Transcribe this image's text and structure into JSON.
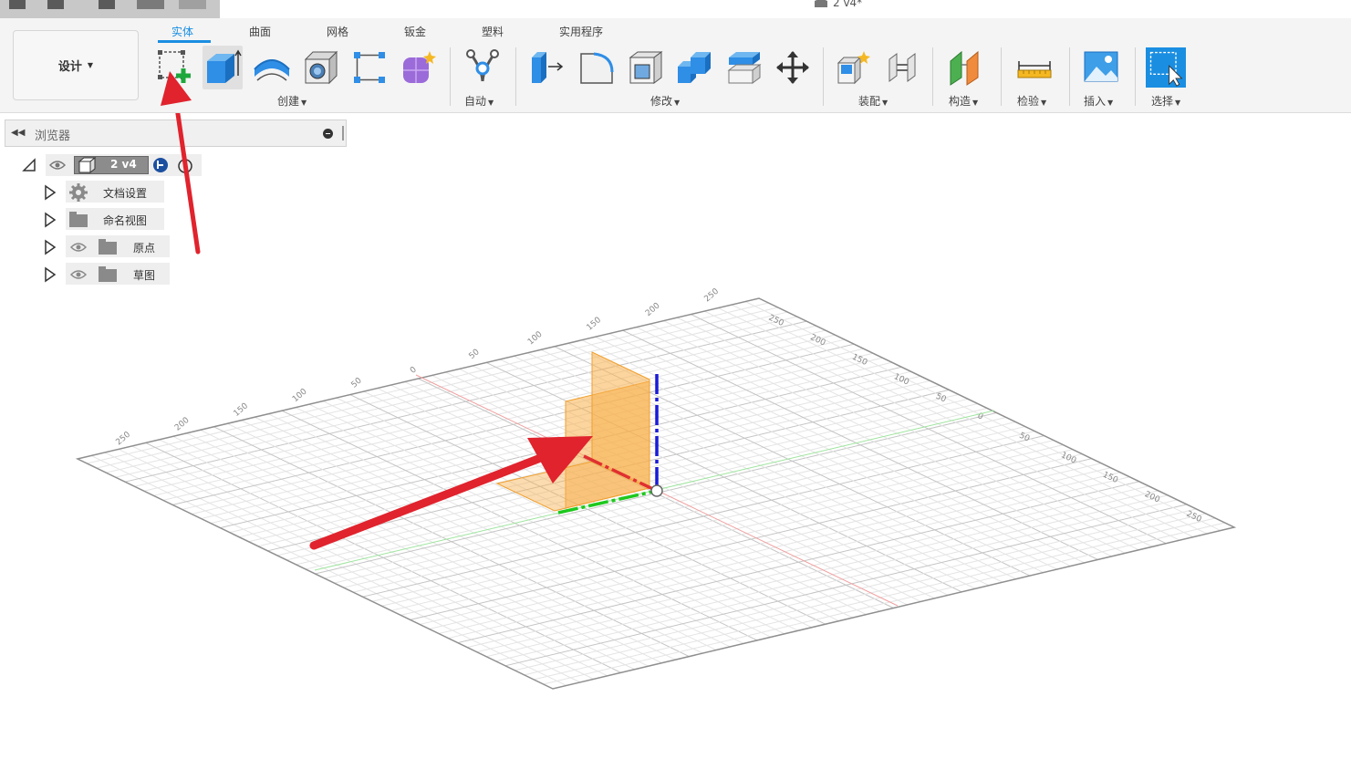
{
  "window": {
    "doc_title": "2 v4*"
  },
  "ribbon": {
    "tabs": [
      {
        "label": "实体",
        "active": true
      },
      {
        "label": "曲面",
        "active": false
      },
      {
        "label": "网格",
        "active": false
      },
      {
        "label": "钣金",
        "active": false
      },
      {
        "label": "塑料",
        "active": false
      },
      {
        "label": "实用程序",
        "active": false
      }
    ],
    "workspace_button": "设计",
    "groups": {
      "create": "创建",
      "automate": "自动",
      "modify": "修改",
      "assemble": "装配",
      "construct": "构造",
      "inspect": "检验",
      "insert": "插入",
      "select": "选择"
    },
    "tools": {
      "create": [
        "new-sketch-icon",
        "extrude-icon",
        "revolve-icon",
        "hole-icon",
        "pattern-icon",
        "form-icon"
      ],
      "automate": [
        "automate-icon"
      ],
      "modify": [
        "press-pull-icon",
        "fillet-icon",
        "shell-icon",
        "combine-icon",
        "offset-face-icon",
        "move-icon"
      ],
      "assemble": [
        "new-component-icon",
        "joint-icon"
      ],
      "construct": [
        "plane-icon"
      ],
      "inspect": [
        "measure-icon"
      ],
      "insert": [
        "insert-image-icon"
      ],
      "select": [
        "select-icon"
      ]
    }
  },
  "browser": {
    "title": "浏览器",
    "root": {
      "label": "2 v4"
    },
    "items": [
      {
        "label": "文档设置",
        "icon": "gear-icon"
      },
      {
        "label": "命名视图",
        "icon": "folder-icon"
      },
      {
        "label": "原点",
        "icon": "folder-icon"
      },
      {
        "label": "草图",
        "icon": "folder-icon"
      }
    ]
  },
  "viewport": {
    "grid_labels_back": [
      "250",
      "200",
      "150",
      "100",
      "50",
      "0",
      "50",
      "100",
      "150",
      "200",
      "250"
    ],
    "grid_labels_right": [
      "250",
      "200",
      "150",
      "100",
      "50",
      "0",
      "50",
      "100",
      "150",
      "200",
      "250"
    ]
  },
  "annotations": {
    "arrow_color": "#e0232d",
    "highlight_plane_color": "#f7b04f"
  },
  "colors": {
    "accent": "#1a8ee1",
    "x_axis": "#e03030",
    "y_axis": "#1ec81e",
    "z_axis": "#1a1ad8"
  }
}
